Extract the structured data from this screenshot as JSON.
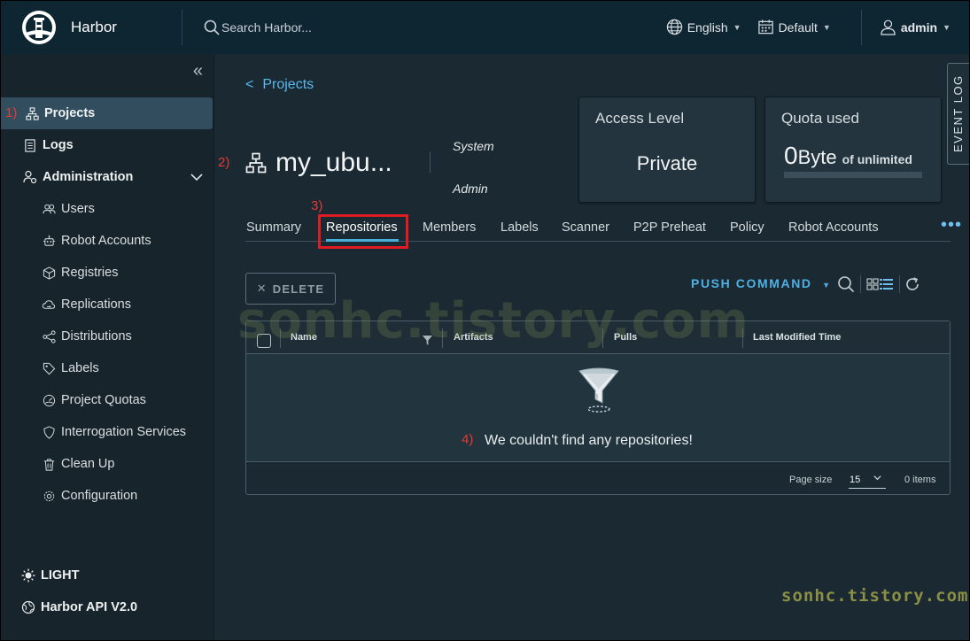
{
  "header": {
    "brand": "Harbor",
    "search_placeholder": "Search Harbor...",
    "language": "English",
    "theme_mode": "Default",
    "user": "admin"
  },
  "sidebar": {
    "items": [
      {
        "label": "Projects",
        "icon": "project-tree-icon"
      },
      {
        "label": "Logs",
        "icon": "log-list-icon"
      },
      {
        "label": "Administration",
        "icon": "admin-users-icon"
      }
    ],
    "admin_items": [
      {
        "label": "Users",
        "icon": "users-icon"
      },
      {
        "label": "Robot Accounts",
        "icon": "robot-icon"
      },
      {
        "label": "Registries",
        "icon": "cube-icon"
      },
      {
        "label": "Replications",
        "icon": "cloud-sync-icon"
      },
      {
        "label": "Distributions",
        "icon": "share-icon"
      },
      {
        "label": "Labels",
        "icon": "tag-icon"
      },
      {
        "label": "Project Quotas",
        "icon": "gauge-icon"
      },
      {
        "label": "Interrogation Services",
        "icon": "shield-icon"
      },
      {
        "label": "Clean Up",
        "icon": "trash-icon"
      },
      {
        "label": "Configuration",
        "icon": "gear-icon"
      }
    ],
    "bottom": {
      "theme": "LIGHT",
      "api": "Harbor API V2.0"
    }
  },
  "annotations": {
    "a1": "1)",
    "a2": "2)",
    "a3": "3)",
    "a4": "4)"
  },
  "project": {
    "breadcrumb": "Projects",
    "breadcrumb_arrow": "<",
    "name": "my_ubu...",
    "role_system": "System",
    "role_admin": "Admin"
  },
  "cards": {
    "access": {
      "title": "Access Level",
      "value": "Private"
    },
    "quota": {
      "title": "Quota used",
      "used": "0",
      "unit": "Byte",
      "of": "of unlimited"
    }
  },
  "event_log": "EVENT LOG",
  "tabs": [
    "Summary",
    "Repositories",
    "Members",
    "Labels",
    "Scanner",
    "P2P Preheat",
    "Policy",
    "Robot Accounts"
  ],
  "tabs_more": "•••",
  "active_tab": "Repositories",
  "toolbar": {
    "delete_label": "DELETE",
    "delete_x": "✕",
    "push_command": "PUSH COMMAND"
  },
  "grid": {
    "columns": [
      "Name",
      "Artifacts",
      "Pulls",
      "Last Modified Time"
    ],
    "empty_message": "We couldn't find any repositories!",
    "page_size_label": "Page size",
    "page_size": "15",
    "items_count": "0 items"
  },
  "watermark": "sonhc.tistory.com",
  "colors": {
    "header_bg": "#0e2532",
    "accent": "#59b9ee",
    "annotation": "#e11b22"
  }
}
